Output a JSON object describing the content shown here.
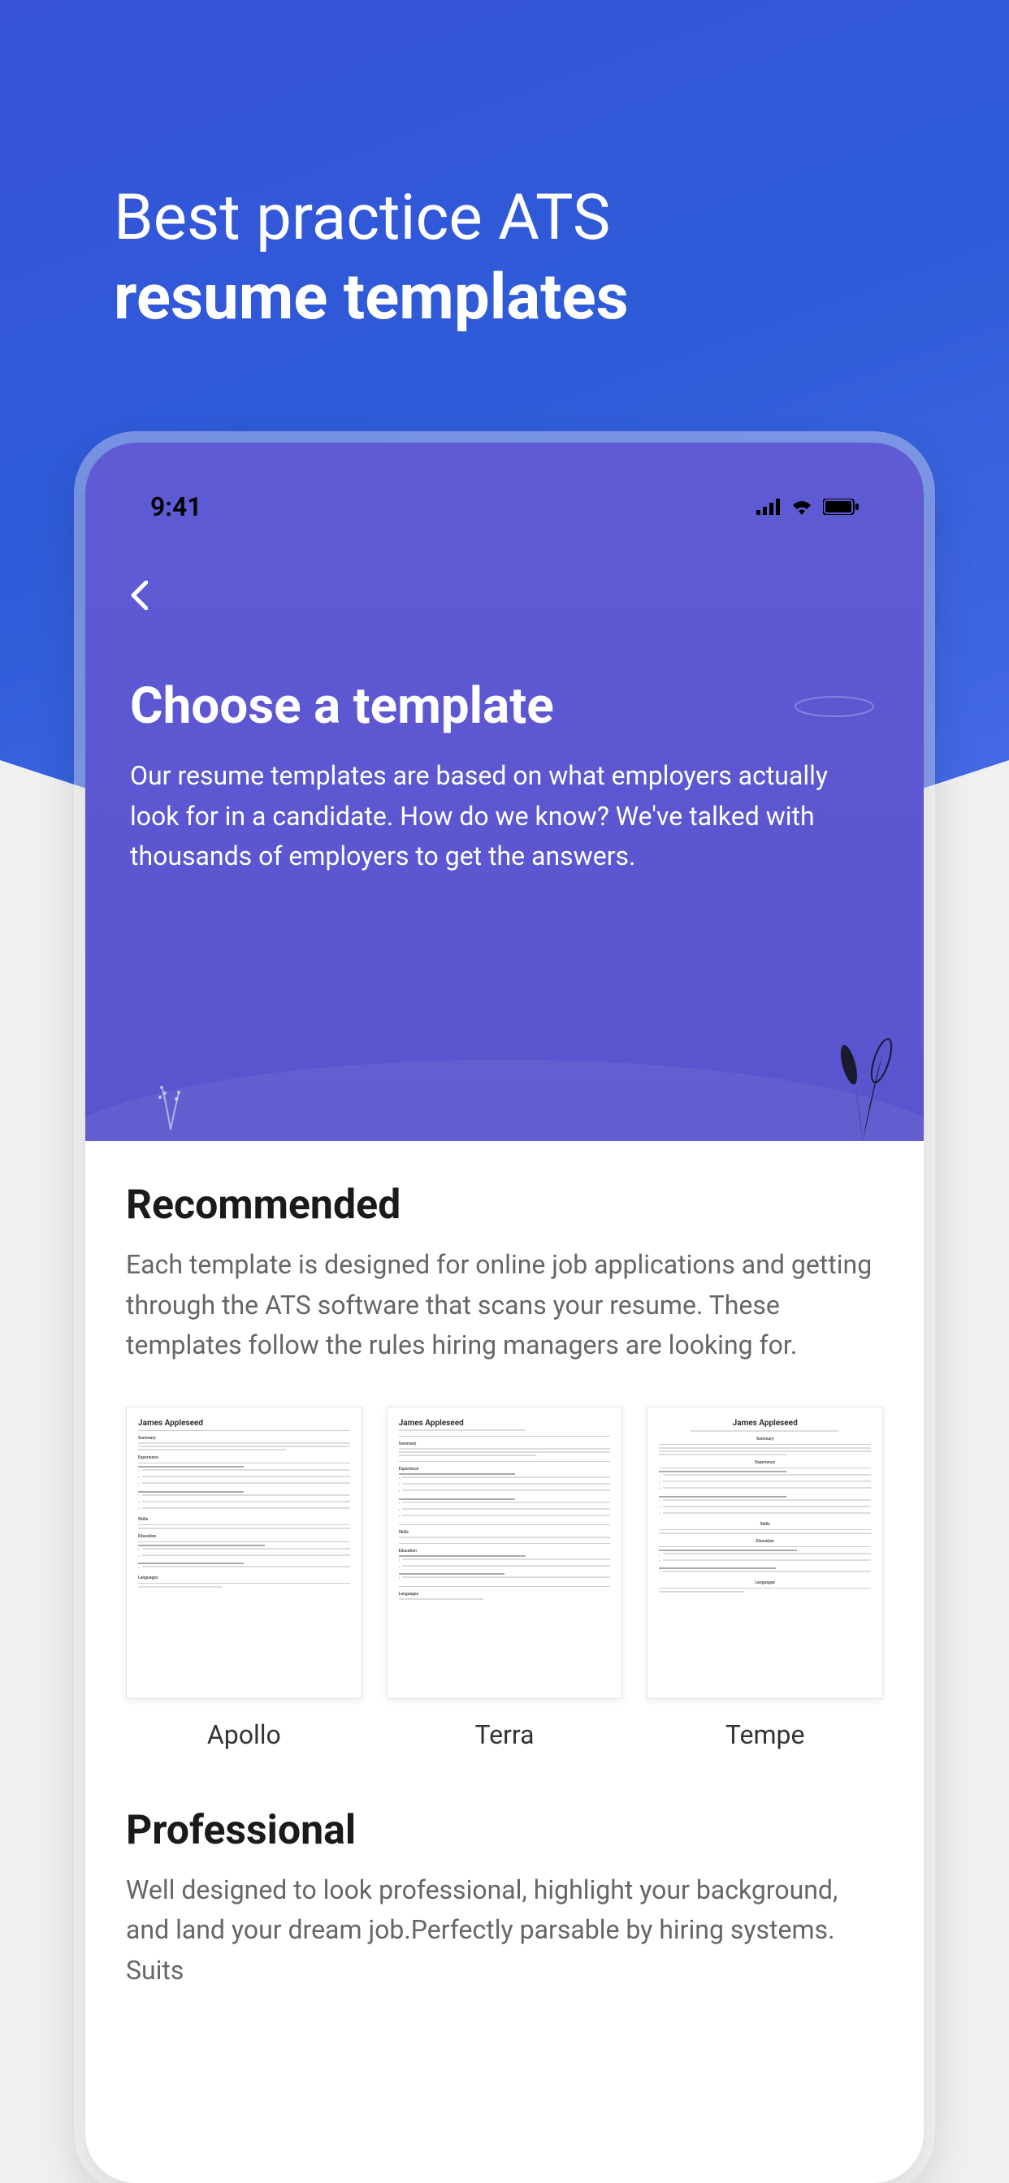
{
  "marketing": {
    "line1": "Best practice ATS",
    "line2": "resume templates"
  },
  "statusBar": {
    "time": "9:41"
  },
  "header": {
    "title": "Choose a template",
    "subtitle": "Our resume templates are based on what employers actually look for in a candidate. How do we know? We've talked with thousands of employers to get the answers."
  },
  "sections": {
    "recommended": {
      "title": "Recommended",
      "description": "Each template is designed for online job applications and getting through the ATS software that scans your resume. These templates follow the rules hiring managers are looking for.",
      "templates": [
        {
          "name": "Apollo",
          "sampleName": "James Appleseed"
        },
        {
          "name": "Terra",
          "sampleName": "James Appleseed"
        },
        {
          "name": "Tempe",
          "sampleName": "James Appleseed"
        }
      ]
    },
    "professional": {
      "title": "Professional",
      "description": "Well designed to look professional, highlight your background, and land your dream job.Perfectly parsable by hiring systems. Suits"
    }
  },
  "resumeSections": {
    "summary": "Summary",
    "experience": "Experience",
    "skills": "Skills",
    "education": "Education",
    "languages": "Languages"
  }
}
